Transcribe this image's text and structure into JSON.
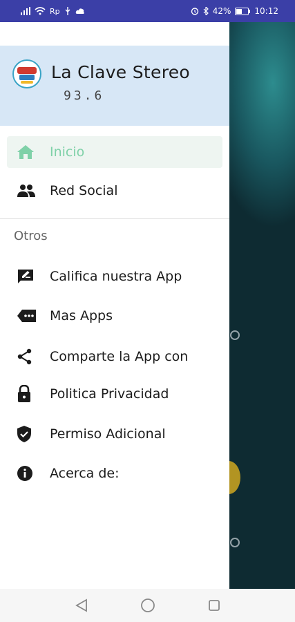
{
  "status_bar": {
    "battery": "42%",
    "time": "10:12"
  },
  "drawer": {
    "header": {
      "title": "La Clave Stereo",
      "frequency": "93.6"
    },
    "primary_items": [
      {
        "label": "Inicio",
        "icon": "home-icon",
        "active": true
      },
      {
        "label": "Red Social",
        "icon": "people-icon",
        "active": false
      }
    ],
    "section_title": "Otros",
    "other_items": [
      {
        "label": "Califica nuestra App",
        "icon": "rate-review-icon"
      },
      {
        "label": "Mas Apps",
        "icon": "more-apps-icon"
      },
      {
        "label": "Comparte la App con",
        "icon": "share-icon"
      },
      {
        "label": "Politica Privacidad",
        "icon": "lock-icon"
      },
      {
        "label": "Permiso Adicional",
        "icon": "verified-shield-icon"
      },
      {
        "label": "Acerca de:",
        "icon": "info-icon"
      }
    ]
  },
  "colors": {
    "status_bar": "#3b3fa7",
    "header_bg": "#d7e7f6",
    "active_text": "#7fd1a8",
    "active_bg": "#eef5f1"
  },
  "nav_bar": {
    "buttons": [
      "back-icon",
      "home-circle-icon",
      "recents-icon"
    ]
  }
}
